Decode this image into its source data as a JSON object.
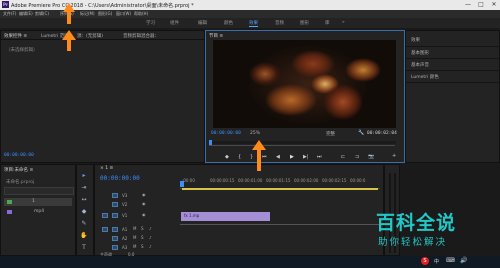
{
  "window": {
    "title": "Adobe Premiere Pro CC 2018 - C:\\Users\\Administrator\\桌面\\未命名.prproj *",
    "app_icon": "Pr",
    "minimize_glyph": "—",
    "maximize_glyph": "□",
    "close_glyph": "✕"
  },
  "menu": [
    "文件(F)",
    "编辑(E)",
    "剪辑(C)",
    "序列(S)",
    "标记(M)",
    "图形(G)",
    "窗口(W)",
    "帮助(H)"
  ],
  "workspaces": {
    "items": [
      "学习",
      "组件",
      "编辑",
      "颜色",
      "效果",
      "音频",
      "图形",
      "库"
    ],
    "active": "效果",
    "overflow": "»"
  },
  "source_panel": {
    "tabs": [
      "效果控件 ≡",
      "Lumetri 范围",
      "源：(无剪辑)",
      "音频剪辑混合器："
    ],
    "empty_text": "（未选择剪辑）",
    "timecode": "00:00:00:00"
  },
  "program": {
    "tab": "节目 ≡",
    "timecode": "00:00:00:00",
    "zoom": "25%",
    "quality": "完整",
    "duration": "00:00:02:04",
    "controls": [
      "◆",
      "{",
      "}",
      "⏮",
      "◀",
      "▶",
      "▶|",
      "⏭",
      "⊏",
      "⊐",
      "📷",
      "+"
    ]
  },
  "effects_panel": {
    "tabs": [
      "效果",
      "基本图形",
      "基本声音",
      "Lumetri 颜色"
    ]
  },
  "project_panel": {
    "tab": "项目:未命名 ≡",
    "filename": "未命名.prproj",
    "items": [
      {
        "name": "1",
        "color": "#4ea64e"
      },
      {
        "name": "mp4",
        "color": "#8a6ad0"
      }
    ]
  },
  "timeline": {
    "tab": "×  1 ≡",
    "timecode": "00:00:00:00",
    "ruler": [
      ":00:00",
      "00:00:00:15",
      "00:00:01:00",
      "00:00:01:15",
      "00:00:02:00",
      "00:00:02:15",
      "00:00:0"
    ],
    "video_tracks": [
      "V3",
      "V2",
      "V1"
    ],
    "audio_tracks": [
      "A1",
      "A2",
      "A3"
    ],
    "clip_label": "fx 1.mp",
    "master_label": "主声道",
    "master_value": "0.0"
  },
  "tools": [
    "▸",
    "⇥",
    "↔",
    "◆",
    "✎",
    "✋",
    "T"
  ],
  "watermark": {
    "title": "百科全说",
    "subtitle": "助你轻松解决"
  },
  "taskbar": {
    "tray": [
      "S",
      "中",
      "⌨",
      "🔊"
    ]
  },
  "colors": {
    "accent": "#3a8fff",
    "arrow": "#ff8a1a",
    "watermark": "#22c7c7",
    "clip": "#a48fd6"
  }
}
